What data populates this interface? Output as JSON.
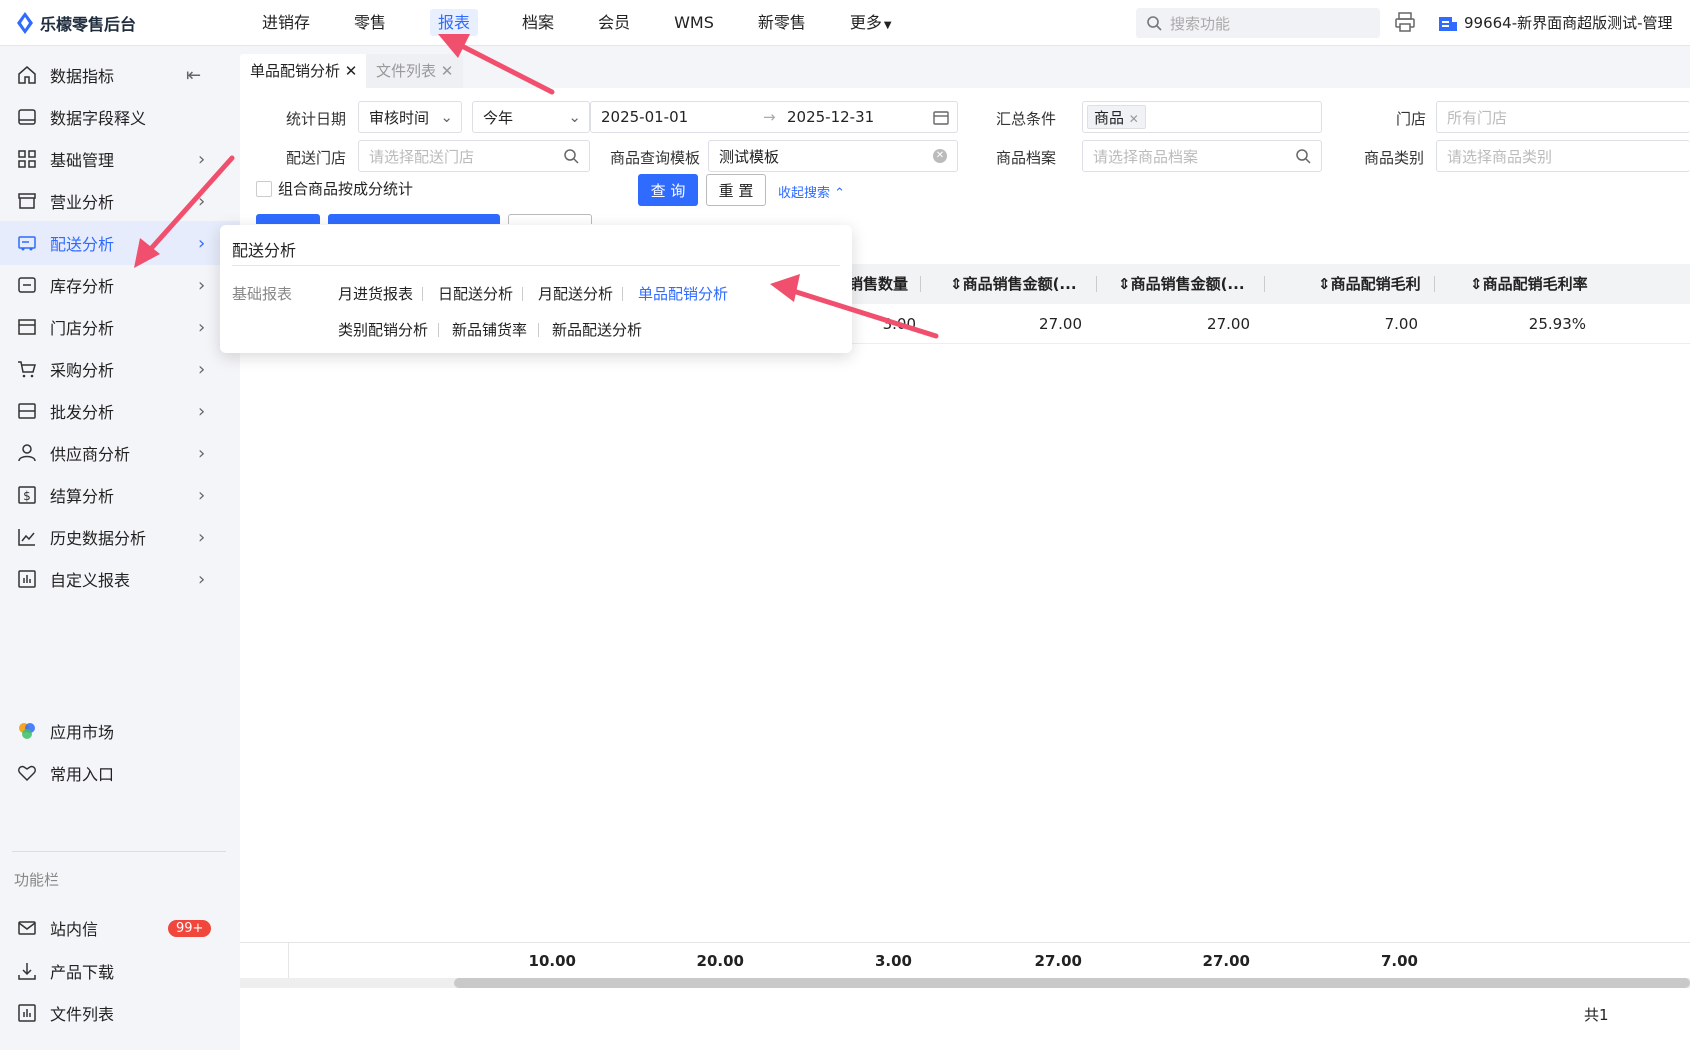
{
  "app": {
    "title": "乐檬零售后台"
  },
  "topnav": {
    "items": [
      "进销存",
      "零售",
      "报表",
      "档案",
      "会员",
      "WMS",
      "新零售",
      "更多"
    ],
    "active": "报表",
    "search_placeholder": "搜索功能",
    "account": "99664-新界面商超版测试-管理"
  },
  "sidebar": {
    "items": [
      "数据指标",
      "数据字段释义",
      "基础管理",
      "营业分析",
      "配送分析",
      "库存分析",
      "门店分析",
      "采购分析",
      "批发分析",
      "供应商分析",
      "结算分析",
      "历史数据分析",
      "自定义报表"
    ],
    "bottom": [
      "应用市场",
      "常用入口"
    ],
    "section_caption": "功能栏",
    "tools": [
      "站内信",
      "产品下载",
      "文件列表"
    ],
    "badge": "99+"
  },
  "tabs": {
    "active": "单品配销分析",
    "inactive": "文件列表"
  },
  "filters": {
    "date_label": "统计日期",
    "date_type": "审核时间",
    "date_range": "今年",
    "start_date": "2025-01-01",
    "end_date": "2025-12-31",
    "summary_label": "汇总条件",
    "summary_tag": "商品",
    "store_label": "门店",
    "store_placeholder": "所有门店",
    "dist_store_label": "配送门店",
    "dist_store_placeholder": "请选择配送门店",
    "template_label": "商品查询模板",
    "template_value": "测试模板",
    "goods_label": "商品档案",
    "goods_placeholder": "请选择商品档案",
    "category_label": "商品类别",
    "category_placeholder": "请选择商品类别",
    "combo_checkbox": "组合商品按成分统计",
    "query_btn": "查 询",
    "reset_btn": "重 置",
    "collapse_link": "收起搜索"
  },
  "table": {
    "headers": [
      "销售数量",
      "商品销售金额(...",
      "商品销售金额(...",
      "商品配销毛利",
      "商品配销毛利率"
    ],
    "row": [
      "3.00",
      "27.00",
      "27.00",
      "7.00",
      "25.93%"
    ],
    "footer": [
      "10.00",
      "20.00",
      "3.00",
      "27.00",
      "27.00",
      "7.00"
    ],
    "total": "共1"
  },
  "popup": {
    "title": "配送分析",
    "caption": "基础报表",
    "row1": [
      "月进货报表",
      "日配送分析",
      "月配送分析",
      "单品配销分析"
    ],
    "row2": [
      "类别配销分析",
      "新品铺货率",
      "新品配送分析"
    ]
  },
  "colors": {
    "accent": "#2f6bff",
    "arrow": "#f0506e",
    "badge": "#f0463c"
  }
}
